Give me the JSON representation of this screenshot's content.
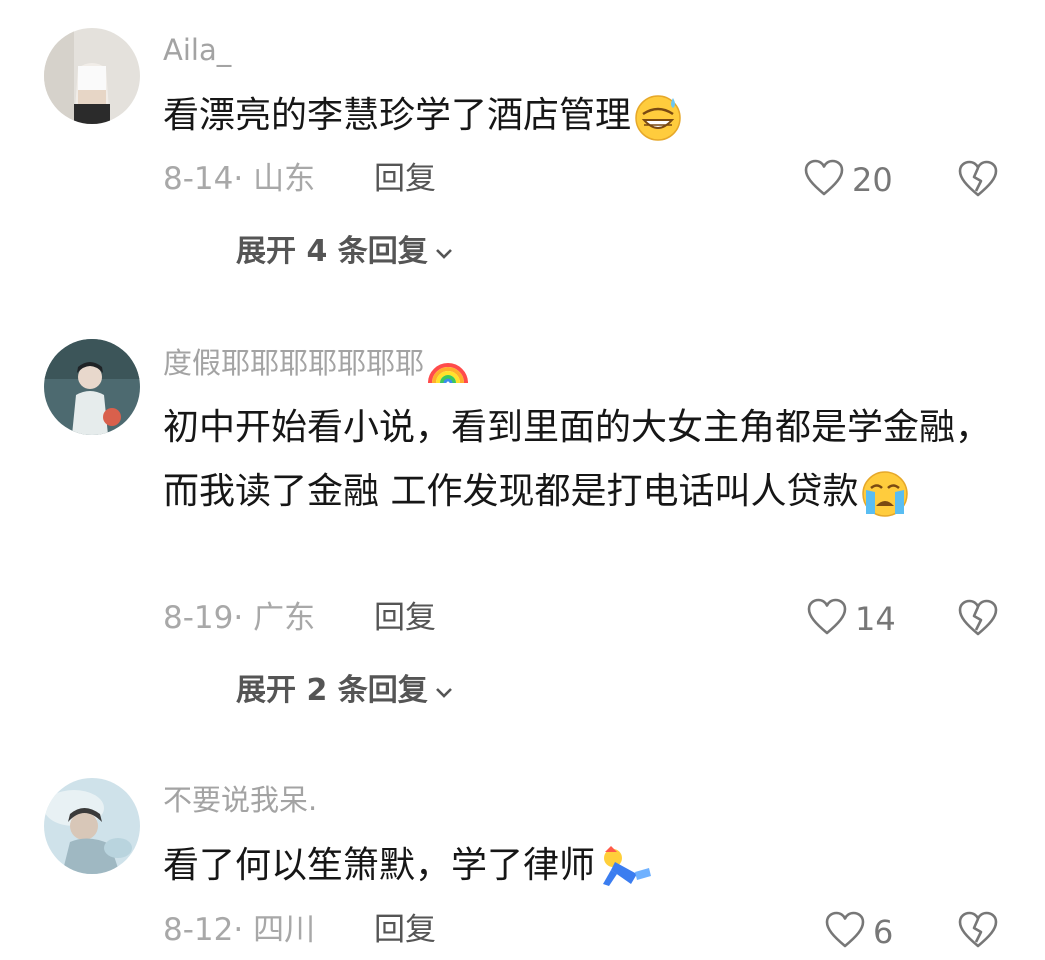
{
  "comments": [
    {
      "username": "Aila_",
      "text": "看漂亮的李慧珍学了酒店管理",
      "emoji": "grinning-sweat-emoji",
      "date_location": "8-14· 山东",
      "reply_label": "回复",
      "likes": "20",
      "expand_label": "展开 4 条回复"
    },
    {
      "username": "度假耶耶耶耶耶耶耶",
      "username_emoji": "rainbow-emoji",
      "text": "初中开始看小说，看到里面的大女主角都是学金融，而我读了金融  工作发现都是打电话叫人贷款",
      "emoji": "crying-face-emoji",
      "date_location": "8-19· 广东",
      "reply_label": "回复",
      "likes": "14",
      "expand_label": "展开 2 条回复"
    },
    {
      "username": "不要说我呆.",
      "text": "看了何以笙箫默，学了律师",
      "emoji": "falling-figure-emoji",
      "date_location": "8-12· 四川",
      "reply_label": "回复",
      "likes": "6"
    }
  ],
  "colors": {
    "username": "#a3a3a3",
    "text": "#161616",
    "meta": "#a8a8a8",
    "reply": "#555555",
    "icon": "#777777"
  }
}
